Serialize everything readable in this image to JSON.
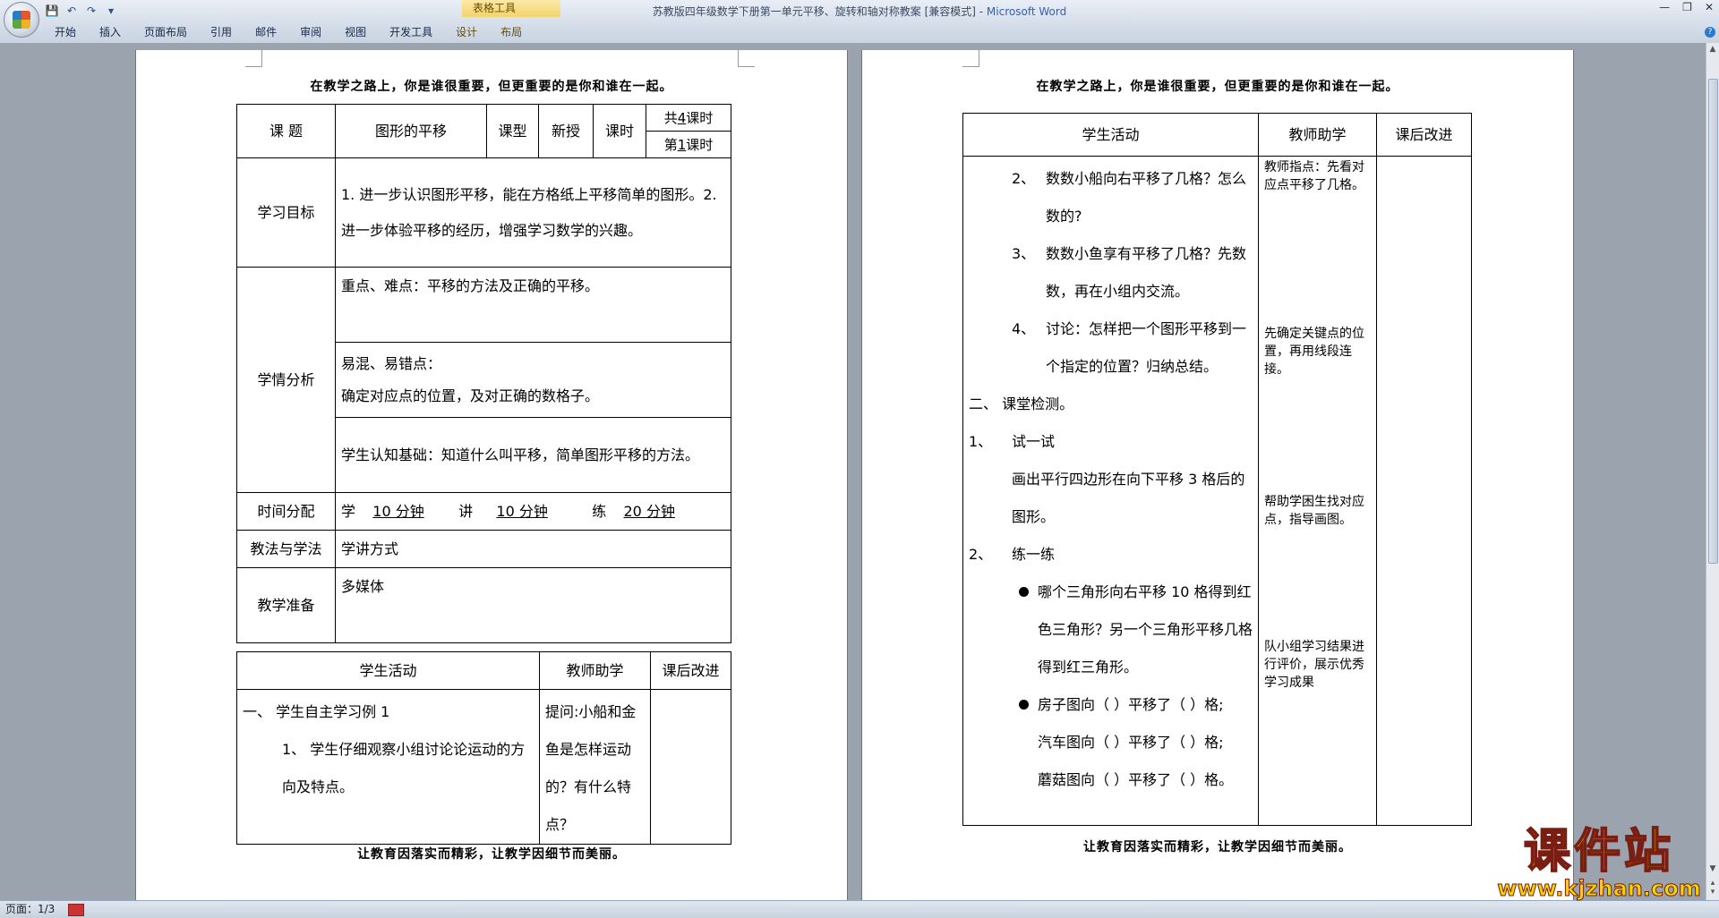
{
  "window": {
    "title": "苏教版四年级数学下册第一单元平移、旋转和轴对称教案 [兼容模式] - ",
    "app_name": "Microsoft Word",
    "context_tools": "表格工具"
  },
  "ribbon": {
    "tabs": [
      "开始",
      "插入",
      "页面布局",
      "引用",
      "邮件",
      "审阅",
      "视图",
      "开发工具",
      "设计",
      "布局"
    ]
  },
  "header_text": "在教学之路上，你是谁很重要，但更重要的是你和谁在一起。",
  "footer_text": "让教育因落实而精彩，让教学因细节而美丽。",
  "page1": {
    "row1": {
      "label": "课  题",
      "topic": "图形的平移",
      "type_label": "课型",
      "type_value": "新授",
      "period_label": "课时",
      "total_pre": "共",
      "total_num": "4",
      "total_post": "课时",
      "nth_pre": "第",
      "nth_num": "1",
      "nth_post": "课时"
    },
    "goals": {
      "label": "学习目标",
      "text": "1. 进一步认识图形平移，能在方格纸上平移简单的图形。2. 进一步体验平移的经历，增强学习数学的兴趣。"
    },
    "analysis": {
      "label": "学情分析",
      "key_points": "重点、难点：平移的方法及正确的平移。",
      "confusion_title": "易混、易错点：",
      "confusion_text": "确定对应点的位置，及对正确的数格子。",
      "basis": "学生认知基础：知道什么叫平移，简单图形平移的方法。"
    },
    "time": {
      "label": "时间分配",
      "learn_label": "学",
      "learn_value": "10 分钟",
      "teach_label": "讲",
      "teach_value": "10 分钟",
      "practice_label": "练",
      "practice_value": "20 分钟"
    },
    "method": {
      "label": "教法与学法",
      "value": "学讲方式"
    },
    "prep": {
      "label": "教学准备",
      "value": "多媒体"
    },
    "activity_head": {
      "student": "学生活动",
      "teacher": "教师助学",
      "revise": "课后改进"
    },
    "activity": {
      "s1": "一、  学生自主学习例 1",
      "s2": "1、  学生仔细观察小组讨论论运动的方向及特点。",
      "teacher": "提问:小船和金鱼是怎样运动的？有什么特点？"
    }
  },
  "page2": {
    "head": {
      "student": "学生活动",
      "teacher": "教师助学",
      "revise": "课后改进"
    },
    "items": [
      {
        "num": "2、",
        "text": "数数小船向右平移了几格？怎么数的?"
      },
      {
        "num": "3、",
        "text": "数数小鱼享有平移了几格？先数数，再在小组内交流。"
      },
      {
        "num": "4、",
        "text": "讨论：怎样把一个图形平移到一个指定的位置？归纳总结。"
      }
    ],
    "section2": "二、  课堂检测。",
    "try_num": "1、",
    "try_title": "试一试",
    "try_text": "画出平行四边形在向下平移 3 格后的图形。",
    "practice_num": "2、",
    "practice_title": "练一练",
    "bullet1": "哪个三角形向右平移 10 格得到红色三角形？另一个三角形平移几格得到红三角形。",
    "bullet2_l1": "房子图向（ ）平移了（ ）格;",
    "bullet2_l2": "汽车图向（ ）平移了（ ）格;",
    "bullet2_l3": "蘑菇图向（ ）平移了（ ）格。",
    "teacher_notes": {
      "n1": "教师指点：先看对应点平移了几格。",
      "n2": "先确定关键点的位置，再用线段连接。",
      "n3": "帮助学困生找对应点，指导画图。",
      "n4": "队小组学习结果进行评价，展示优秀学习成果"
    }
  },
  "status": {
    "page": "页面：1/3"
  },
  "watermark": {
    "big": "课件站",
    "url": "www.kjzhan.com"
  }
}
